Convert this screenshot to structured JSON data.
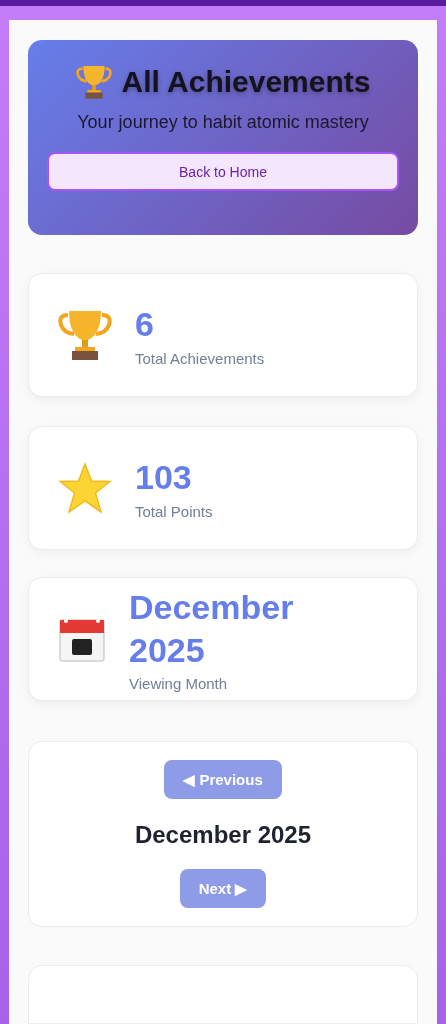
{
  "header": {
    "title": "All Achievements",
    "subtitle": "Your journey to habit atomic mastery",
    "back_button": "Back to Home"
  },
  "stats": [
    {
      "kind": "trophy",
      "value": "6",
      "label": "Total Achievements"
    },
    {
      "kind": "star",
      "value": "103",
      "label": "Total Points"
    },
    {
      "kind": "calendar",
      "value": "December 2025",
      "label": "Viewing Month"
    }
  ],
  "month_nav": {
    "previous": {
      "label": "◀ Previous",
      "disabled": true
    },
    "month": "December 2025",
    "next": {
      "label": "Next ▶",
      "disabled": true
    }
  }
}
